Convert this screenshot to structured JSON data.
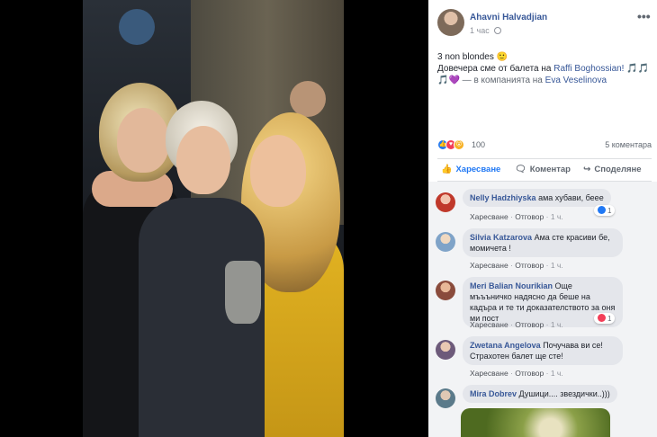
{
  "post": {
    "author": "Ahavni Halvadjian",
    "time": "1 час",
    "more_icon": "•••",
    "text_line1": "3 non blondes 🙂",
    "text_line2_pre": "Довечера сме от балета на ",
    "text_line2_link": "Raffi Boghossian!",
    "text_notes1": " 🎵🎵",
    "text_notes2": "🎵💜",
    "text_with": " — в компанията на ",
    "text_with_link": "Eva Veselinova"
  },
  "reactions": {
    "count": "100",
    "comments": "5 коментара"
  },
  "actions": {
    "like": "Харесване",
    "comment": "Коментар",
    "share": "Споделяне"
  },
  "comments": [
    {
      "name": "Nelly Hadzhiyska",
      "text": "ама хубави, беее",
      "like": "Харесване",
      "reply": "Отговор",
      "time": "1 ч.",
      "reaction_count": "1",
      "avatar_color": "#c0392b"
    },
    {
      "name": "Silvia Katzarova",
      "text": "Ама сте красиви бе, момичета !",
      "like": "Харесване",
      "reply": "Отговор",
      "time": "1 ч.",
      "avatar_color": "#7fa3c8"
    },
    {
      "name": "Meri Balian Nourikian",
      "text": "Още мъъъничко надясно да беше на кадъра и те ти доказателството за оня ми пост",
      "like": "Харесване",
      "reply": "Отговор",
      "time": "1 ч.",
      "reaction_count": "1",
      "avatar_color": "#8a4b3c"
    },
    {
      "name": "Zwetana Angelova",
      "text": "Почучава ви се! Страхотен балет ще сте!",
      "like": "Харесване",
      "reply": "Отговор",
      "time": "1 ч.",
      "avatar_color": "#6d5a7a"
    },
    {
      "name": "Mira Dobrev",
      "text": "Душици.... звездички..)))",
      "avatar_color": "#5b7a8a"
    }
  ]
}
